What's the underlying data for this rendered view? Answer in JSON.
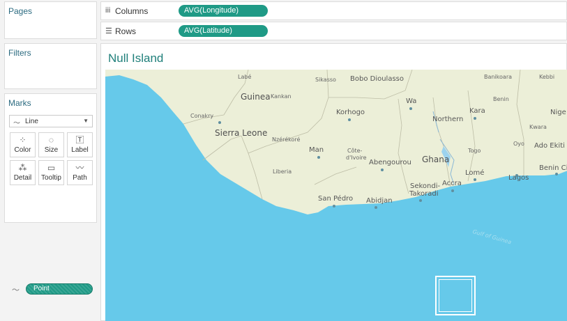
{
  "panes": {
    "pages": "Pages",
    "filters": "Filters",
    "marks": "Marks"
  },
  "marks": {
    "type_label": "Line",
    "cards": [
      "Color",
      "Size",
      "Label",
      "Detail",
      "Tooltip",
      "Path"
    ],
    "field_pill": "Point"
  },
  "shelves": {
    "columns_label": "Columns",
    "columns_pill": "AVG(Longitude)",
    "rows_label": "Rows",
    "rows_pill": "AVG(Latitude)"
  },
  "view": {
    "title": "Null Island"
  },
  "map": {
    "labels": {
      "guinea": "Guinea",
      "kankan": "Kankan",
      "labe": "Labé",
      "sikasso": "Sikasso",
      "bobo": "Bobo Dioulasso",
      "banikoara": "Banikoara",
      "kebbi": "Kebbi",
      "conakry": "Conakry",
      "korhogo": "Korhogo",
      "wa": "Wa",
      "kara": "Kara",
      "benin": "Benin",
      "niger": "Nige",
      "sierra_leone": "Sierra Leone",
      "northern": "Northern",
      "kwara": "Kwara",
      "nzerekore": "Nzérékoré",
      "man": "Man",
      "cote": "Côte-",
      "divoire": "d'Ivoire",
      "ghana": "Ghana",
      "togo": "Togo",
      "oyo": "Oyo",
      "ado_ekiti": "Ado Ekiti",
      "liberia": "Liberia",
      "abengourou": "Abengourou",
      "lome": "Lomé",
      "benin_city": "Benin Ci",
      "lagos": "Lagos",
      "sekondi": "Sekondi-",
      "takoradi": "Takoradi",
      "accra": "Accra",
      "san_pedro": "San Pédro",
      "abidjan": "Abidjan",
      "gulf": "Gulf of Guinea"
    }
  },
  "colors": {
    "accent": "#1f9a86",
    "title": "#1f7f7a",
    "water": "#66c9ea",
    "land": "#ecefd8"
  }
}
